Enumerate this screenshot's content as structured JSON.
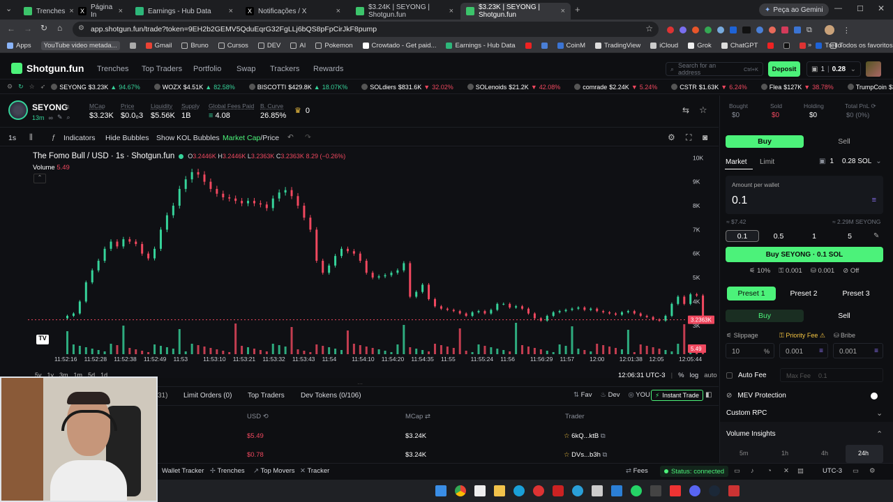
{
  "browser": {
    "tabs": [
      {
        "title": "Trenches",
        "color": "#3cc46b"
      },
      {
        "title": "Página In",
        "color": "#111"
      },
      {
        "title": "Earnings - Hub Data",
        "color": "#2db77a"
      },
      {
        "title": "Notificações / X",
        "color": "#111"
      },
      {
        "title": "$3.24K | SEYONG | Shotgun.fun",
        "color": "#3cc46b"
      },
      {
        "title": "$3.23K | SEYONG | Shotgun.fun",
        "color": "#3cc46b"
      }
    ],
    "gemini_label": "Peça ao Gemini",
    "url": "app.shotgun.fun/trade?token=9EH2b2GEMV5QduEqrG32FgLLj6bQS8pFpCirJkF8pump",
    "bookmarks": [
      "Apps",
      "YouTube video metada...",
      "Gmail",
      "Bruno",
      "Cursos",
      "DEV",
      "AI",
      "Pokemon",
      "Crowtado - Get paid...",
      "Earnings - Hub Data",
      "CoinM",
      "TradingView",
      "iCloud",
      "Grok",
      "ChatGPT",
      "Trello"
    ],
    "all_favorites": "Todos os favoritos"
  },
  "app": {
    "logo": "Shotgun.fun",
    "nav": [
      "Trenches",
      "Top Traders",
      "Portfolio",
      "Swap",
      "Trackers",
      "Rewards"
    ],
    "search_placeholder": "Search for an address",
    "search_shortcut": "Ctrl+K",
    "deposit_label": "Deposit",
    "wallet_count": "1",
    "wallet_balance": "0.28"
  },
  "ticker": [
    {
      "name": "SEYONG",
      "price": "$3.23K",
      "change": "94.67%",
      "dir": "up"
    },
    {
      "name": "WOZX",
      "price": "$4.51K",
      "change": "82.58%",
      "dir": "up"
    },
    {
      "name": "BISCOTTI",
      "price": "$429.8K",
      "change": "18.07K%",
      "dir": "up"
    },
    {
      "name": "SOLdiers",
      "price": "$831.6K",
      "change": "32.02%",
      "dir": "down"
    },
    {
      "name": "SOLenoids",
      "price": "$21.2K",
      "change": "42.08%",
      "dir": "down"
    },
    {
      "name": "comrade",
      "price": "$2.24K",
      "change": "5.24%",
      "dir": "down"
    },
    {
      "name": "CSTR",
      "price": "$1.63K",
      "change": "6.24%",
      "dir": "down"
    },
    {
      "name": "Flea",
      "price": "$127K",
      "change": "38.78%",
      "dir": "down"
    },
    {
      "name": "TrumpCoin",
      "price": "$393.7K",
      "change": "42.76%",
      "dir": "down"
    }
  ],
  "token": {
    "symbol": "SEYONG",
    "age": "13m",
    "stats": [
      {
        "label": "MCap",
        "value": "$3.23K"
      },
      {
        "label": "Price",
        "value": "$0.0₀3"
      },
      {
        "label": "Liquidity",
        "value": "$5.56K"
      },
      {
        "label": "Supply",
        "value": "1B"
      },
      {
        "label": "Global Fees Paid",
        "value": "4.08"
      },
      {
        "label": "B. Curve",
        "value": "26.85%"
      }
    ],
    "crown_count": "0"
  },
  "chart_toolbar": {
    "interval": "1s",
    "indicators": "Indicators",
    "hide_bubbles": "Hide Bubbles",
    "show_kol": "Show KOL Bubbles",
    "market_cap": "Market Cap",
    "price": "/Price"
  },
  "chart_data": {
    "type": "candlestick",
    "title": "The Fomo Bull / USD · 1s · Shotgun.fun",
    "ohlc": {
      "o": "3.2446K",
      "h": "3.2446K",
      "l": "3.2363K",
      "c": "3.2363K",
      "chg": "8.29 (−0.26%)"
    },
    "volume_label": "Volume",
    "volume_value": "5.49",
    "y_ticks": [
      "10K",
      "9K",
      "8K",
      "7K",
      "6K",
      "5K",
      "4K",
      "3K",
      "2K"
    ],
    "ylim": [
      1800,
      10300
    ],
    "x_ticks": [
      "11:52:16",
      "11:52:28",
      "11:52:38",
      "11:52:49",
      "11:53",
      "11:53:10",
      "11:53:21",
      "11:53:32",
      "11:53:43",
      "11:54",
      "11:54:10",
      "11:54:20",
      "11:54:35",
      "11:55",
      "11:55:24",
      "11:56",
      "11:56:29",
      "11:57",
      "12:00",
      "12:01:38",
      "12:05",
      "12:05:44"
    ],
    "last_price_label": "3.2363K",
    "last_volume_label": "5.49",
    "close_path": [
      3400,
      3500,
      4000,
      4800,
      5300,
      5700,
      6200,
      6500,
      6300,
      6600,
      6500,
      6400,
      6000,
      5800,
      6200,
      7000,
      7600,
      8000,
      8700,
      9100,
      9400,
      9300,
      9000,
      8700,
      8500,
      8350,
      8300,
      8200,
      8100,
      8200,
      8100,
      8050,
      7900,
      8300,
      8550,
      8650,
      8400,
      8000,
      7500,
      7000,
      5700,
      5200,
      5500,
      5900,
      6200,
      6100,
      6000,
      5700,
      5200,
      5000,
      5050,
      5100,
      5200,
      5300,
      5600,
      4200,
      4400,
      4700,
      4100,
      3800,
      3700,
      3650,
      3600,
      3500,
      3400,
      3550,
      3600,
      3500,
      3650,
      3900,
      3900,
      3750,
      3800,
      3700,
      3500,
      3300,
      3200,
      3400,
      3550,
      3600,
      3650,
      3700,
      3750,
      3650,
      3700,
      3600,
      3550,
      3500,
      3450,
      3550,
      3600,
      3500,
      3400,
      3350,
      3250,
      3200,
      3400,
      3900,
      4200,
      3900,
      4300,
      4250,
      3237
    ],
    "timezone_clock": "12:06:31 UTC-3",
    "range_buttons": [
      "5y",
      "1y",
      "3m",
      "1m",
      "5d",
      "1d"
    ],
    "scale_buttons": [
      "%",
      "log",
      "auto"
    ]
  },
  "bottom": {
    "tabs": [
      "Limit Orders (0)",
      "Top Traders",
      "Dev Tokens (0/106)"
    ],
    "partial_tab": "31)",
    "filters": [
      "Fav",
      "Dev",
      "YOU"
    ],
    "instant_trade": "Instant Trade",
    "columns": [
      "USD",
      "MCap",
      "Trader"
    ],
    "rows": [
      {
        "usd": "$5.49",
        "mcap": "$3.24K",
        "trader": "6kQ...ktB"
      },
      {
        "usd": "$0.78",
        "mcap": "$3.24K",
        "trader": "DVs...b3h"
      }
    ]
  },
  "status": {
    "items": [
      "Wallet Tracker",
      "Trenches",
      "Top Movers",
      "Tracker"
    ],
    "fees": "Fees",
    "connection": "Status: connected",
    "tz": "UTC-3"
  },
  "right": {
    "bought_label": "Bought",
    "bought": "$0",
    "sold_label": "Sold",
    "sold": "$0",
    "holding_label": "Holding",
    "holding": "$0",
    "pnl_label": "Total PnL",
    "pnl": "$0 (0%)",
    "buy_tab": "Buy",
    "sell_tab": "Sell",
    "market": "Market",
    "limit": "Limit",
    "wallet_n": "1",
    "wallet_sol": "0.28 SOL",
    "amount_label": "Amount per wallet",
    "amount": "0.1",
    "usd_est": "≈ $7.42",
    "token_est": "≈ 2.29M SEYONG",
    "quick": [
      "0.1",
      "0.5",
      "1",
      "5"
    ],
    "buy_button": "Buy SEYONG · 0.1 SOL",
    "slip": "10%",
    "prio": "0.001",
    "bribe": "0.001",
    "mev": "Off",
    "presets": [
      "Preset 1",
      "Preset 2",
      "Preset 3"
    ],
    "sub_buy": "Buy",
    "sub_sell": "Sell",
    "slippage_label": "Slippage",
    "priority_label": "Priority Fee",
    "bribe_label": "Bribe",
    "slippage_val": "10",
    "priority_val": "0.001",
    "bribe_val": "0.001",
    "auto_fee": "Auto Fee",
    "max_fee_label": "Max Fee",
    "max_fee_val": "0.1",
    "mev_protection": "MEV Protection",
    "custom_rpc": "Custom RPC",
    "volume_insights": "Volume Insights",
    "vi_tabs": [
      "5m",
      "1h",
      "4h",
      "24h"
    ]
  },
  "colors": {
    "green": "#36d39a",
    "red": "#f0485f",
    "accent": "#4cf27a"
  }
}
